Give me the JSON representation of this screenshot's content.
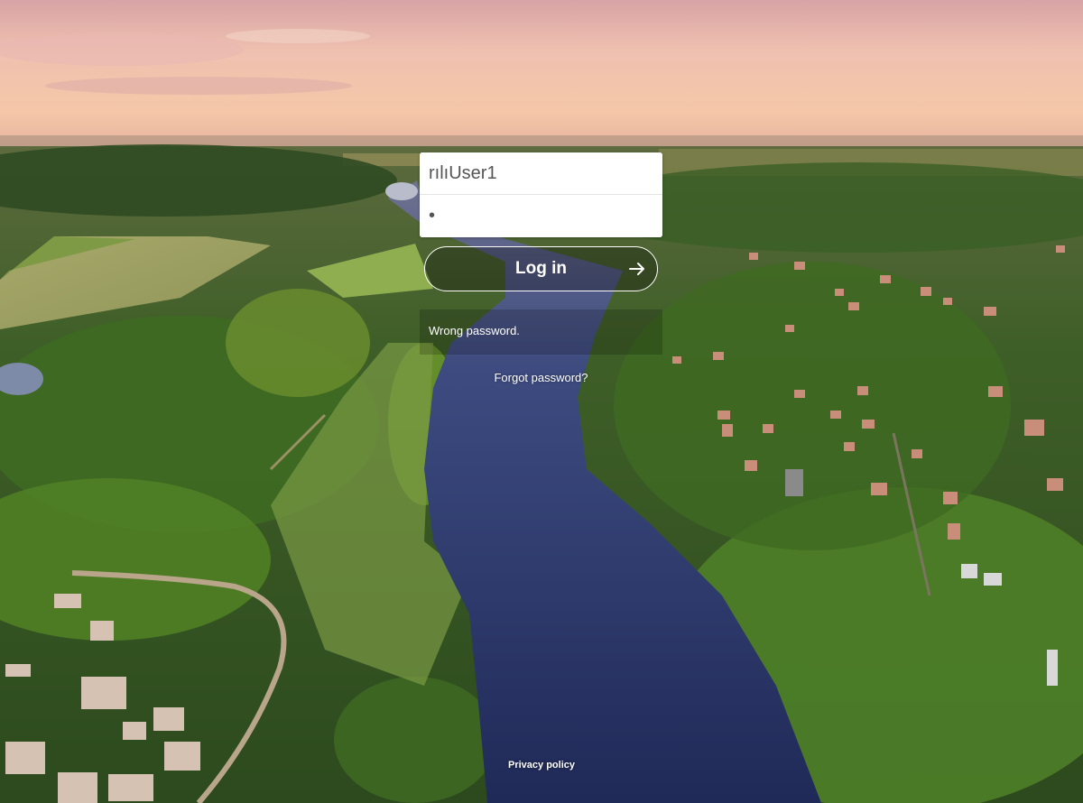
{
  "login": {
    "username_value": "rılıUser1",
    "password_value": "•",
    "submit_label": "Log in",
    "warning_text": "Wrong password.",
    "forgot_label": "Forgot password?"
  },
  "footer": {
    "privacy_label": "Privacy policy"
  },
  "colors": {
    "field_bg": "#ffffff",
    "text_on_image": "#ffffff",
    "river": "#2e3a6e",
    "forest": "#3d5f25",
    "sky_top": "#f3c4b0"
  },
  "icons": {
    "submit_arrow": "arrow-right-icon"
  }
}
